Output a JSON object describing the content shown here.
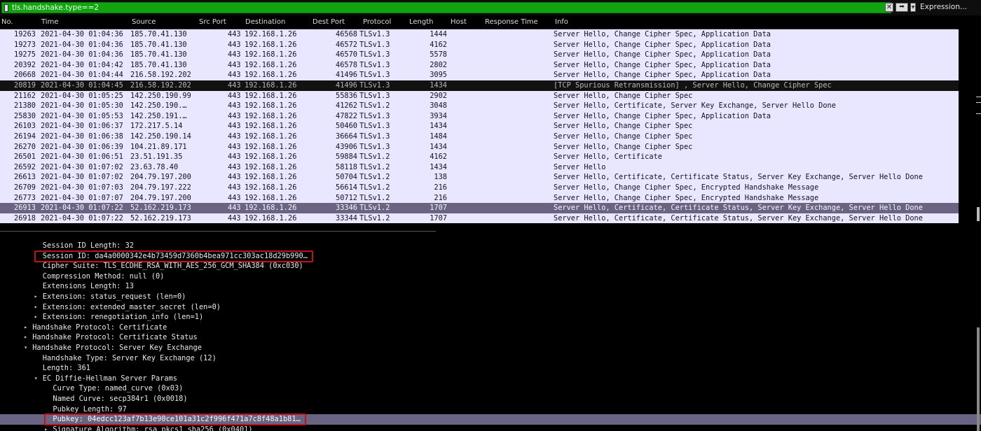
{
  "filter": {
    "value": "tls.handshake.type==2",
    "clear_label": "✕",
    "apply_label": "➡",
    "dropdown_label": "▼",
    "expression_label": "Expression..."
  },
  "columns": [
    "No.",
    "Time",
    "Source",
    "Src Port",
    "Destination",
    "Dest Port",
    "Protocol",
    "Length",
    "Host",
    "Response Time",
    "Info"
  ],
  "packets": [
    {
      "no": "19263",
      "time": "2021-04-30 01:04:36",
      "src": "185.70.41.130",
      "sport": "443",
      "dst": "192.168.1.26",
      "dport": "46568",
      "proto": "TLSv1.3",
      "len": "1444",
      "info": "Server Hello, Change Cipher Spec, Application Data"
    },
    {
      "no": "19273",
      "time": "2021-04-30 01:04:36",
      "src": "185.70.41.130",
      "sport": "443",
      "dst": "192.168.1.26",
      "dport": "46572",
      "proto": "TLSv1.3",
      "len": "4162",
      "info": "Server Hello, Change Cipher Spec, Application Data"
    },
    {
      "no": "19275",
      "time": "2021-04-30 01:04:36",
      "src": "185.70.41.130",
      "sport": "443",
      "dst": "192.168.1.26",
      "dport": "46570",
      "proto": "TLSv1.3",
      "len": "5578",
      "info": "Server Hello, Change Cipher Spec, Application Data"
    },
    {
      "no": "20392",
      "time": "2021-04-30 01:04:42",
      "src": "185.70.41.130",
      "sport": "443",
      "dst": "192.168.1.26",
      "dport": "46578",
      "proto": "TLSv1.3",
      "len": "2802",
      "info": "Server Hello, Change Cipher Spec, Application Data"
    },
    {
      "no": "20668",
      "time": "2021-04-30 01:04:44",
      "src": "216.58.192.202",
      "sport": "443",
      "dst": "192.168.1.26",
      "dport": "41496",
      "proto": "TLSv1.3",
      "len": "3095",
      "info": "Server Hello, Change Cipher Spec, Application Data"
    },
    {
      "no": "20819",
      "time": "2021-04-30 01:04:45",
      "src": "216.58.192.202",
      "sport": "443",
      "dst": "192.168.1.26",
      "dport": "41496",
      "proto": "TLSv1.3",
      "len": "1434",
      "info": "[TCP Spurious Retransmission] , Server Hello, Change Cipher Spec",
      "style": "spurious"
    },
    {
      "no": "21162",
      "time": "2021-04-30 01:05:25",
      "src": "142.250.190.99",
      "sport": "443",
      "dst": "192.168.1.26",
      "dport": "55836",
      "proto": "TLSv1.3",
      "len": "2902",
      "info": "Server Hello, Change Cipher Spec"
    },
    {
      "no": "21380",
      "time": "2021-04-30 01:05:30",
      "src": "142.250.190.…",
      "sport": "443",
      "dst": "192.168.1.26",
      "dport": "41262",
      "proto": "TLSv1.2",
      "len": "3048",
      "info": "Server Hello, Certificate, Server Key Exchange, Server Hello Done"
    },
    {
      "no": "25830",
      "time": "2021-04-30 01:05:53",
      "src": "142.250.191.…",
      "sport": "443",
      "dst": "192.168.1.26",
      "dport": "47822",
      "proto": "TLSv1.3",
      "len": "3934",
      "info": "Server Hello, Change Cipher Spec, Application Data"
    },
    {
      "no": "26103",
      "time": "2021-04-30 01:06:37",
      "src": "172.217.5.14",
      "sport": "443",
      "dst": "192.168.1.26",
      "dport": "50460",
      "proto": "TLSv1.3",
      "len": "1434",
      "info": "Server Hello, Change Cipher Spec"
    },
    {
      "no": "26194",
      "time": "2021-04-30 01:06:38",
      "src": "142.250.190.14",
      "sport": "443",
      "dst": "192.168.1.26",
      "dport": "36664",
      "proto": "TLSv1.3",
      "len": "1484",
      "info": "Server Hello, Change Cipher Spec"
    },
    {
      "no": "26270",
      "time": "2021-04-30 01:06:39",
      "src": "104.21.89.171",
      "sport": "443",
      "dst": "192.168.1.26",
      "dport": "43906",
      "proto": "TLSv1.3",
      "len": "1434",
      "info": "Server Hello, Change Cipher Spec"
    },
    {
      "no": "26501",
      "time": "2021-04-30 01:06:51",
      "src": "23.51.191.35",
      "sport": "443",
      "dst": "192.168.1.26",
      "dport": "59884",
      "proto": "TLSv1.2",
      "len": "4162",
      "info": "Server Hello, Certificate"
    },
    {
      "no": "26592",
      "time": "2021-04-30 01:07:02",
      "src": "23.63.78.40",
      "sport": "443",
      "dst": "192.168.1.26",
      "dport": "58118",
      "proto": "TLSv1.2",
      "len": "1434",
      "info": "Server Hello"
    },
    {
      "no": "26613",
      "time": "2021-04-30 01:07:02",
      "src": "204.79.197.200",
      "sport": "443",
      "dst": "192.168.1.26",
      "dport": "50704",
      "proto": "TLSv1.2",
      "len": "138",
      "info": "Server Hello, Certificate, Certificate Status, Server Key Exchange, Server Hello Done"
    },
    {
      "no": "26709",
      "time": "2021-04-30 01:07:03",
      "src": "204.79.197.222",
      "sport": "443",
      "dst": "192.168.1.26",
      "dport": "56614",
      "proto": "TLSv1.2",
      "len": "216",
      "info": "Server Hello, Change Cipher Spec, Encrypted Handshake Message"
    },
    {
      "no": "26773",
      "time": "2021-04-30 01:07:07",
      "src": "204.79.197.200",
      "sport": "443",
      "dst": "192.168.1.26",
      "dport": "50712",
      "proto": "TLSv1.2",
      "len": "216",
      "info": "Server Hello, Change Cipher Spec, Encrypted Handshake Message"
    },
    {
      "no": "26913",
      "time": "2021-04-30 01:07:22",
      "src": "52.162.219.173",
      "sport": "443",
      "dst": "192.168.1.26",
      "dport": "33346",
      "proto": "TLSv1.2",
      "len": "1707",
      "info": "Server Hello, Certificate, Certificate Status, Server Key Exchange, Server Hello Done",
      "style": "selected"
    },
    {
      "no": "26918",
      "time": "2021-04-30 01:07:22",
      "src": "52.162.219.173",
      "sport": "443",
      "dst": "192.168.1.26",
      "dport": "33344",
      "proto": "TLSv1.2",
      "len": "1707",
      "info": "Server Hello, Certificate, Certificate Status, Server Key Exchange, Server Hello Done"
    }
  ],
  "details": [
    {
      "indent": 4,
      "text": "Session ID Length: 32"
    },
    {
      "indent": 4,
      "text": "Session ID: da4a0000342e4b73459d7360b4bea971cc303ac18d29b990…",
      "redbox": true
    },
    {
      "indent": 4,
      "text": "Cipher Suite: TLS_ECDHE_RSA_WITH_AES_256_GCM_SHA384 (0xc030)"
    },
    {
      "indent": 4,
      "text": "Compression Method: null (0)"
    },
    {
      "indent": 4,
      "text": "Extensions Length: 13"
    },
    {
      "indent": 4,
      "arrow": "▸",
      "text": "Extension: status_request (len=0)"
    },
    {
      "indent": 4,
      "arrow": "▸",
      "text": "Extension: extended_master_secret (len=0)"
    },
    {
      "indent": 4,
      "arrow": "▸",
      "text": "Extension: renegotiation_info (len=1)"
    },
    {
      "indent": 3,
      "arrow": "▸",
      "text": "Handshake Protocol: Certificate"
    },
    {
      "indent": 3,
      "arrow": "▸",
      "text": "Handshake Protocol: Certificate Status"
    },
    {
      "indent": 3,
      "arrow": "▾",
      "text": "Handshake Protocol: Server Key Exchange"
    },
    {
      "indent": 4,
      "text": "Handshake Type: Server Key Exchange (12)"
    },
    {
      "indent": 4,
      "text": "Length: 361"
    },
    {
      "indent": 4,
      "arrow": "▾",
      "text": "EC Diffie-Hellman Server Params"
    },
    {
      "indent": 5,
      "text": "Curve Type: named_curve (0x03)"
    },
    {
      "indent": 5,
      "text": "Named Curve: secp384r1 (0x0018)"
    },
    {
      "indent": 5,
      "text": "Pubkey Length: 97"
    },
    {
      "indent": 5,
      "text": "Pubkey: 04edcc123af7b13e90ce101a31c2f996f471a7c8f48a1b81…",
      "redbox": true,
      "highlight": true
    },
    {
      "indent": 5,
      "arrow": "▸",
      "text": "Signature Algorithm: rsa_pkcs1_sha256 (0x0401)"
    }
  ]
}
